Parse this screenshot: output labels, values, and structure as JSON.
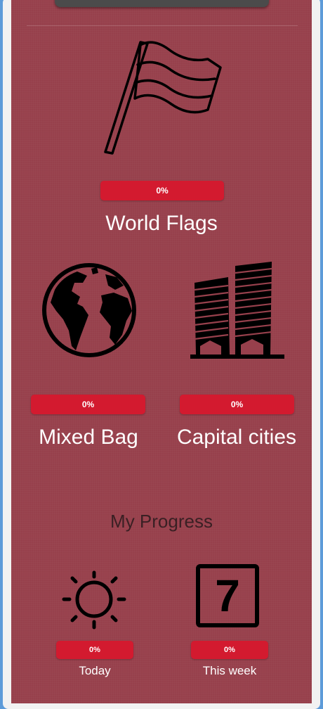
{
  "categories": [
    {
      "title": "World Flags",
      "progress_label": "0%",
      "progress": 0,
      "icon": "flag-icon"
    },
    {
      "title": "Mixed Bag",
      "progress_label": "0%",
      "progress": 0,
      "icon": "globe-icon"
    },
    {
      "title": "Capital cities",
      "progress_label": "0%",
      "progress": 0,
      "icon": "buildings-icon"
    }
  ],
  "progress_section": {
    "title": "My Progress",
    "items": [
      {
        "label": "Today",
        "progress_label": "0%",
        "progress": 0,
        "icon": "sun-icon"
      },
      {
        "label": "This week",
        "progress_label": "0%",
        "progress": 0,
        "icon": "calendar-7-icon",
        "calendar_number": "7"
      }
    ]
  },
  "colors": {
    "panel": "#97404c",
    "progress_bar": "#d31a2f",
    "frame_border": "#5d9bd9"
  }
}
